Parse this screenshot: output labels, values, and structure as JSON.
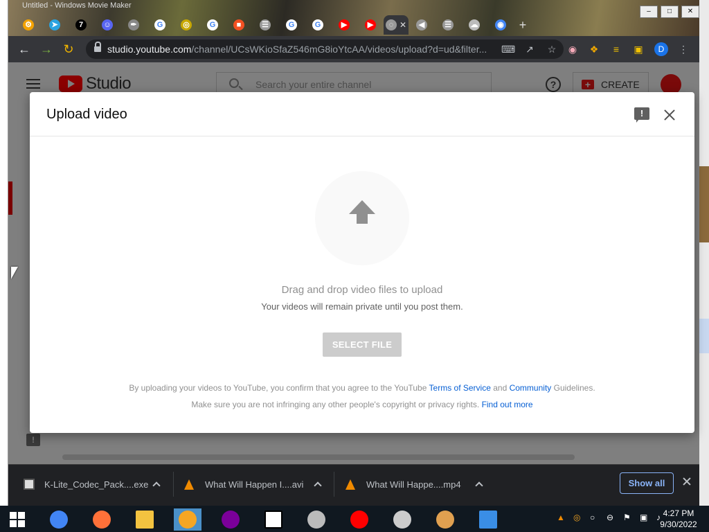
{
  "window": {
    "title": "Untitled - Windows Movie Maker",
    "controls": [
      "–",
      "□",
      "✕"
    ]
  },
  "tabs": [
    {
      "icon": "settings-favicon",
      "color": "#f4a300",
      "glyph": "⚙"
    },
    {
      "icon": "telegram-favicon",
      "color": "#2aa3e0",
      "glyph": "➤"
    },
    {
      "icon": "7-favicon",
      "color": "#000000",
      "glyph": "7"
    },
    {
      "icon": "discord-favicon",
      "color": "#5865f2",
      "glyph": "☺"
    },
    {
      "icon": "feather-favicon",
      "color": "#888888",
      "glyph": "✒"
    },
    {
      "icon": "google-favicon",
      "color": "#ffffff",
      "glyph": "G"
    },
    {
      "icon": "search-favicon",
      "color": "#c8a800",
      "glyph": "◎"
    },
    {
      "icon": "google-favicon",
      "color": "#ffffff",
      "glyph": "G"
    },
    {
      "icon": "microsoft-favicon",
      "color": "#f25022",
      "glyph": "■"
    },
    {
      "icon": "generic-favicon",
      "color": "#999999",
      "glyph": "☰"
    },
    {
      "icon": "google-favicon",
      "color": "#ffffff",
      "glyph": "G"
    },
    {
      "icon": "google-favicon",
      "color": "#ffffff",
      "glyph": "G"
    },
    {
      "icon": "youtube-favicon",
      "color": "#ff0000",
      "glyph": "▶"
    },
    {
      "icon": "youtube-favicon",
      "color": "#ff0000",
      "glyph": "▶"
    },
    {
      "icon": "loading-favicon",
      "color": "#999999",
      "glyph": "◌",
      "active": true
    },
    {
      "icon": "audio-favicon",
      "color": "#999999",
      "glyph": "◀"
    },
    {
      "icon": "generic-favicon",
      "color": "#999999",
      "glyph": "☰"
    },
    {
      "icon": "cloud-favicon",
      "color": "#bbbbbb",
      "glyph": "☁"
    },
    {
      "icon": "chrome-favicon",
      "color": "#4285f4",
      "glyph": "◉"
    }
  ],
  "toolbar": {
    "url_host": "studio.youtube.com",
    "url_path": "/channel/UCsWKioSfaZ546mG8ioYtcAA/videos/upload?d=ud&filter...",
    "profile_initial": "D"
  },
  "studio": {
    "logo_text": "Studio",
    "search_placeholder": "Search your entire channel",
    "help_glyph": "?",
    "create_label": "CREATE",
    "create_glyph": "+",
    "feedback_glyph": "!"
  },
  "modal": {
    "title": "Upload video",
    "drag_text": "Drag and drop video files to upload",
    "private_text": "Your videos will remain private until you post them.",
    "select_button": "SELECT FILE",
    "legal_prefix": "By uploading your videos to YouTube, you confirm that you agree to the YouTube ",
    "terms_link": "Terms of Service",
    "legal_and": " and ",
    "community_link": "Community",
    "legal_suffix": " Guidelines.",
    "rights_text": "Make sure you are not infringing any other people's copyright or privacy rights. ",
    "find_out_link": "Find out more"
  },
  "downloads": {
    "items": [
      {
        "name": "K-Lite_Codec_Pack....exe",
        "type": "exe"
      },
      {
        "name": "What Will Happen I....avi",
        "type": "vlc"
      },
      {
        "name": "What Will Happe....mp4",
        "type": "vlc"
      }
    ],
    "show_all": "Show all"
  },
  "taskbar": {
    "apps": [
      {
        "name": "chrome",
        "color": "#4285f4"
      },
      {
        "name": "firefox",
        "color": "#ff7139"
      },
      {
        "name": "file-explorer",
        "color": "#f3c340"
      },
      {
        "name": "search-app",
        "color": "#f5a623",
        "active": true
      },
      {
        "name": "yahoo-messenger",
        "color": "#7b0099"
      },
      {
        "name": "7zip",
        "color": "#ffffff"
      },
      {
        "name": "settings-gear",
        "color": "#bbbbbb"
      },
      {
        "name": "youtube",
        "color": "#ff0000"
      },
      {
        "name": "video-reel",
        "color": "#cccccc"
      },
      {
        "name": "paint",
        "color": "#e0a050"
      },
      {
        "name": "notepad",
        "color": "#3a8ee6"
      }
    ],
    "tray_glyphs": [
      "▲",
      "◎",
      "○",
      "⊖",
      "⚑",
      "▣",
      "♪"
    ],
    "time": "4:27 PM",
    "date": "9/30/2022"
  }
}
